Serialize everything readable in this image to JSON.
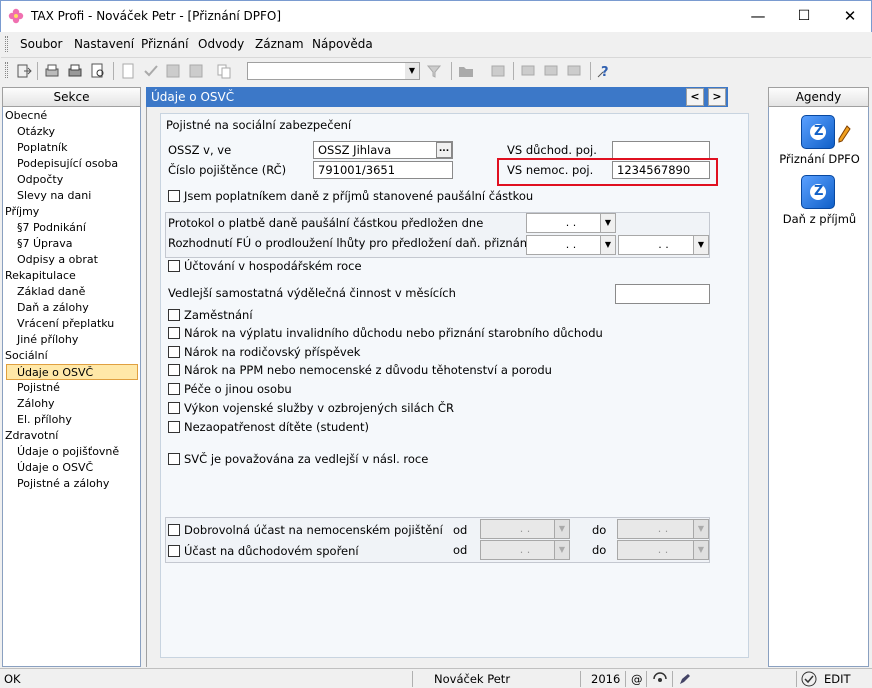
{
  "window": {
    "title": "TAX Profi - Nováček Petr - [Přiznání DPFO]",
    "min": "—",
    "max": "☐",
    "close": "✕"
  },
  "menu": [
    "Soubor",
    "Nastavení",
    "Přiznání",
    "Odvody",
    "Záznam",
    "Nápověda"
  ],
  "sekce": {
    "title": "Sekce",
    "items": [
      {
        "label": "Obecné",
        "level": 0
      },
      {
        "label": "Otázky",
        "level": 1
      },
      {
        "label": "Poplatník",
        "level": 1
      },
      {
        "label": "Podepisující osoba",
        "level": 1
      },
      {
        "label": "Odpočty",
        "level": 1
      },
      {
        "label": "Slevy na dani",
        "level": 1
      },
      {
        "label": "Příjmy",
        "level": 0
      },
      {
        "label": "§7 Podnikání",
        "level": 1
      },
      {
        "label": "§7 Úprava",
        "level": 1
      },
      {
        "label": "Odpisy a obrat",
        "level": 1
      },
      {
        "label": "Rekapitulace",
        "level": 0
      },
      {
        "label": "Základ daně",
        "level": 1
      },
      {
        "label": "Daň a zálohy",
        "level": 1
      },
      {
        "label": "Vrácení přeplatku",
        "level": 1
      },
      {
        "label": "Jiné přílohy",
        "level": 1
      },
      {
        "label": "Sociální",
        "level": 0
      },
      {
        "label": "Údaje o OSVČ",
        "level": 1,
        "selected": true
      },
      {
        "label": "Pojistné",
        "level": 1
      },
      {
        "label": "Zálohy",
        "level": 1
      },
      {
        "label": "El. přílohy",
        "level": 1
      },
      {
        "label": "Zdravotní",
        "level": 0
      },
      {
        "label": "Údaje o pojišťovně",
        "level": 1
      },
      {
        "label": "Údaje o OSVČ",
        "level": 1
      },
      {
        "label": "Pojistné a zálohy",
        "level": 1
      }
    ]
  },
  "main": {
    "header": "Údaje o OSVČ",
    "nav_prev": "<",
    "nav_next": ">",
    "section_title": "Pojistné na sociální zabezpečení",
    "ossz_label": "OSSZ v, ve",
    "ossz_value": "OSSZ Jihlava",
    "ossz_btn": "...",
    "cislo_label": "Číslo pojištěnce (RČ)",
    "cislo_value": "791001/3651",
    "vs_duchod_label": "VS důchod. poj.",
    "vs_duchod_value": "",
    "vs_nemoc_label": "VS nemoc. poj.",
    "vs_nemoc_value": "1234567890",
    "pausal_label": "Jsem poplatníkem daně z příjmů stanovené paušální částkou",
    "protokol_label": "Protokol o platbě daně paušální částkou předložen dne",
    "rozhodnuti_label": "Rozhodnutí FÚ o prodloužení lhůty pro předložení daň. přiznání",
    "date_placeholder": ". .",
    "uctovani_label": "Účtování v hospodářském roce",
    "vedlejsi_label": "Vedlejší samostatná výdělečná činnost v měsících",
    "vedlejsi_value": "",
    "checks": [
      "Zaměstnání",
      "Nárok na výplatu invalidního důchodu nebo přiznání starobního důchodu",
      "Nárok na rodičovský příspěvek",
      "Nárok na PPM nebo nemocenské z důvodu těhotenství a porodu",
      "Péče o jinou osobu",
      "Výkon vojenské služby v ozbrojených silách ČR",
      "Nezaopatřenost dítěte (student)"
    ],
    "svc_label": "SVČ je považována za vedlejší v násl. roce",
    "dobrovolna_label": "Dobrovolná účast na nemocenském pojištění",
    "duchodove_label": "Účast na důchodovém spoření",
    "od_label": "od",
    "do_label": "do"
  },
  "agendy": {
    "title": "Agendy",
    "items": [
      "Přiznání DPFO",
      "Daň z příjmů"
    ]
  },
  "status": {
    "left": "OK",
    "user": "Nováček Petr",
    "year": "2016",
    "at": "@",
    "mode": "EDIT"
  },
  "colors": {
    "accent": "#3c78c8",
    "highlight": "#e01020",
    "selected": "#ffe8a8"
  }
}
